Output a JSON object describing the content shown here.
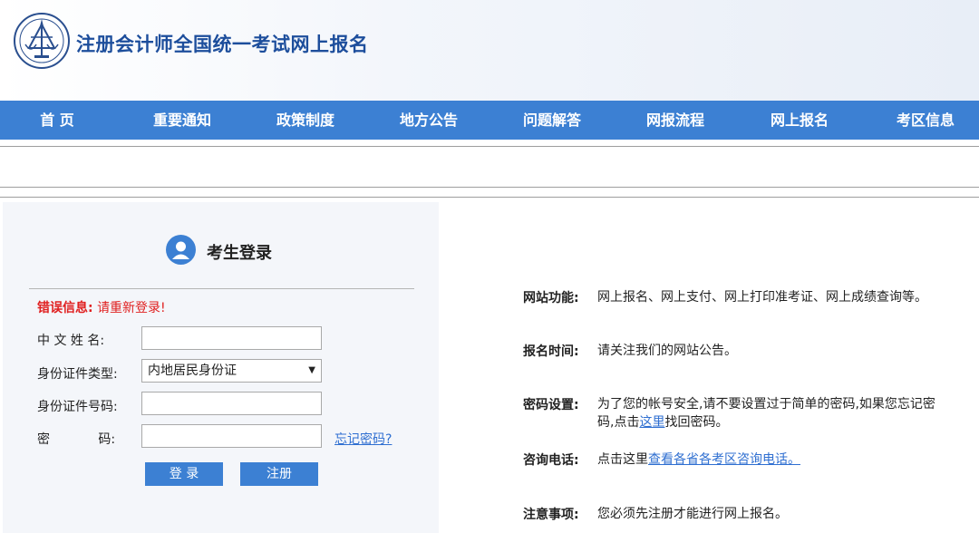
{
  "header": {
    "title": "注册会计师全国统一考试网上报名",
    "logo_icon": "cpa-association-logo-icon",
    "colors": {
      "title": "#1d4e9c",
      "nav_bg": "#3c80d3"
    }
  },
  "nav": {
    "items": [
      {
        "label": "首 页"
      },
      {
        "label": "重要通知"
      },
      {
        "label": "政策制度"
      },
      {
        "label": "地方公告"
      },
      {
        "label": "问题解答"
      },
      {
        "label": "网报流程"
      },
      {
        "label": "网上报名"
      },
      {
        "label": "考区信息"
      }
    ]
  },
  "login": {
    "title": "考生登录",
    "user_icon": "user-icon",
    "error_label": "错误信息:",
    "error_message": "请重新登录!",
    "fields": {
      "name_label": "中 文 姓 名:",
      "name_value": "",
      "id_type_label": "身份证件类型:",
      "id_type_selected": "内地居民身份证",
      "id_number_label": "身份证件号码:",
      "id_number_value": "",
      "password_label": "密            码:",
      "password_value": ""
    },
    "forgot_password": "忘记密码?",
    "login_button": "登 录",
    "register_button": "注册"
  },
  "info": {
    "features_label": "网站功能:",
    "features_text": "网上报名、网上支付、网上打印准考证、网上成绩查询等。",
    "signup_time_label": "报名时间:",
    "signup_time_text": "请关注我们的网站公告。",
    "password_setting_label": "密码设置:",
    "password_setting_text_before": "为了您的帐号安全,请不要设置过于简单的密码,如果您忘记密码,点击",
    "password_setting_link": "这里",
    "password_setting_text_after": "找回密码。",
    "phone_label": "咨询电话:",
    "phone_text_before": "点击这里",
    "phone_link": "查看各省各考区咨询电话。",
    "notice_label": "注意事项:",
    "notice_text": "您必须先注册才能进行网上报名。"
  }
}
